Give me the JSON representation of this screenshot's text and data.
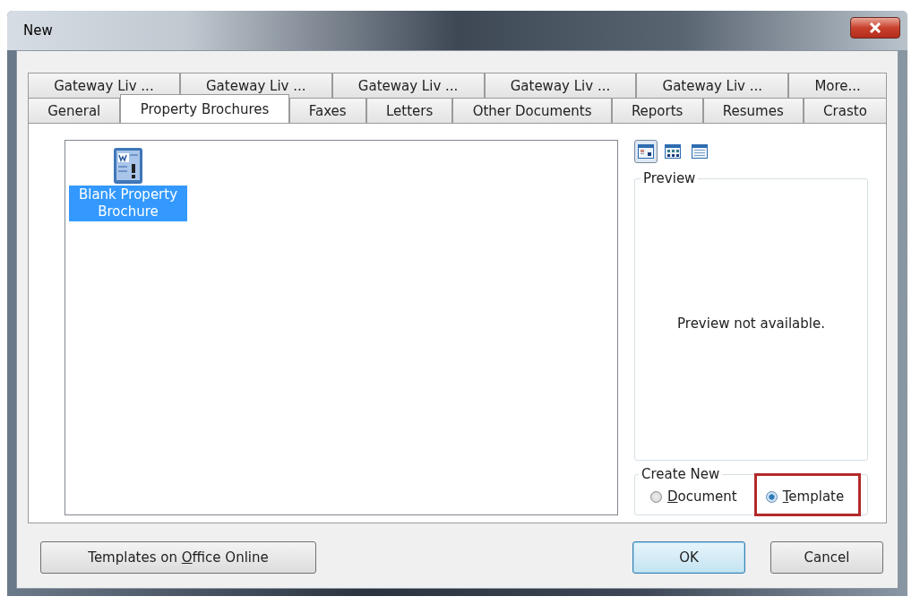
{
  "window": {
    "title": "New"
  },
  "tab_rows": [
    [
      {
        "label": "Gateway Liv ...",
        "selected": false
      },
      {
        "label": "Gateway Liv ...",
        "selected": false
      },
      {
        "label": "Gateway Liv ...",
        "selected": false
      },
      {
        "label": "Gateway Liv ...",
        "selected": false
      },
      {
        "label": "Gateway Liv ...",
        "selected": false
      },
      {
        "label": "More...",
        "selected": false
      }
    ],
    [
      {
        "label": "General",
        "selected": false
      },
      {
        "label": "Property Brochures",
        "selected": true
      },
      {
        "label": "Faxes",
        "selected": false
      },
      {
        "label": "Letters",
        "selected": false
      },
      {
        "label": "Other Documents",
        "selected": false
      },
      {
        "label": "Reports",
        "selected": false
      },
      {
        "label": "Resumes",
        "selected": false
      },
      {
        "label": "Crasto",
        "selected": false
      }
    ]
  ],
  "templates": [
    {
      "label": "Blank Property Brochure",
      "selected": true
    }
  ],
  "view_buttons": [
    {
      "kind": "large-icons",
      "selected": true
    },
    {
      "kind": "list",
      "selected": false
    },
    {
      "kind": "details",
      "selected": false
    }
  ],
  "preview": {
    "title": "Preview",
    "message": "Preview not available."
  },
  "create_new": {
    "title": "Create New",
    "options": [
      {
        "label": [
          {
            "text": "D",
            "underlined": true
          },
          {
            "text": "ocument",
            "underlined": false
          }
        ],
        "selected": false,
        "highlighted": false
      },
      {
        "label": [
          {
            "text": "T",
            "underlined": true
          },
          {
            "text": "emplate",
            "underlined": false
          }
        ],
        "selected": true,
        "highlighted": true
      }
    ]
  },
  "buttons": [
    {
      "kind": "left",
      "label": [
        {
          "text": "Templates on ",
          "underlined": false
        },
        {
          "text": "O",
          "underlined": true
        },
        {
          "text": "ffice Online",
          "underlined": false
        }
      ],
      "default": false
    },
    {
      "kind": "right",
      "label": [
        {
          "text": "OK",
          "underlined": false
        }
      ],
      "default": true
    },
    {
      "kind": "right",
      "label": [
        {
          "text": "Cancel",
          "underlined": false
        }
      ],
      "default": false
    }
  ]
}
